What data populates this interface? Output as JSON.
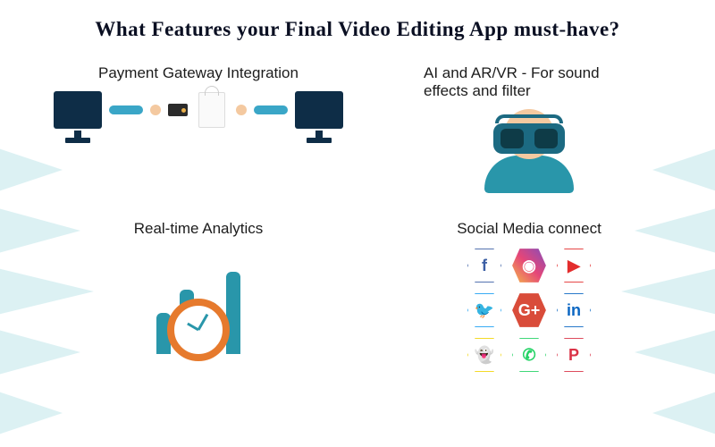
{
  "title": "What Features your Final Video Editing App must-have?",
  "features": {
    "payment_gateway": {
      "label": "Payment Gateway Integration"
    },
    "ar_vr": {
      "label": "AI and AR/VR - For sound effects and filter"
    },
    "analytics": {
      "label": "Real-time Analytics"
    },
    "social": {
      "label": "Social Media connect"
    }
  },
  "social_icons": [
    {
      "name": "facebook",
      "glyph": "f"
    },
    {
      "name": "instagram",
      "glyph": "◉"
    },
    {
      "name": "youtube",
      "glyph": "▶"
    },
    {
      "name": "twitter",
      "glyph": "🐦"
    },
    {
      "name": "google-plus",
      "glyph": "G+"
    },
    {
      "name": "linkedin",
      "glyph": "in"
    },
    {
      "name": "snapchat",
      "glyph": "👻"
    },
    {
      "name": "whatsapp",
      "glyph": "✆"
    },
    {
      "name": "pinterest",
      "glyph": "P"
    }
  ],
  "colors": {
    "accent_teal": "#2996aa",
    "accent_orange": "#e67a2d",
    "bg_triangle": "#bfe5e9"
  }
}
